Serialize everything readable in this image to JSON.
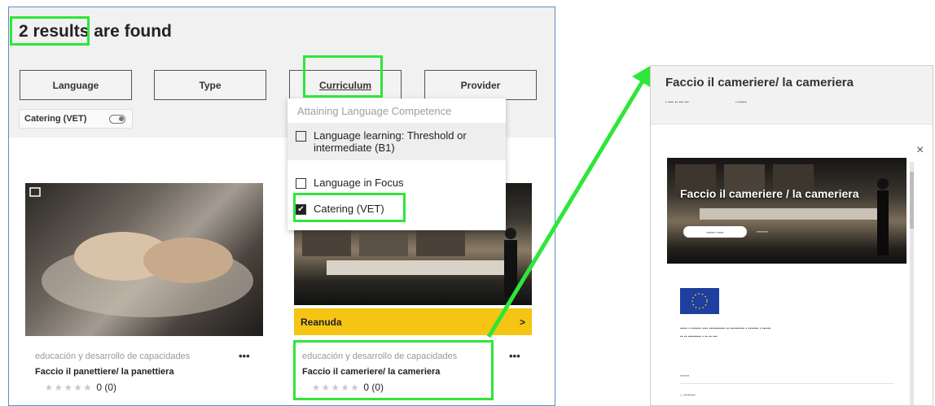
{
  "results": {
    "title": "2 results are found"
  },
  "filters": {
    "language": "Language",
    "type": "Type",
    "curriculum": "Curriculum",
    "provider": "Provider",
    "chip_label": "Catering (VET)"
  },
  "dropdown": {
    "heading": "Attaining Language Competence",
    "options": [
      {
        "label": "Language learning: Threshold or intermediate (B1)",
        "checked": false
      },
      {
        "label": "Language in Focus",
        "checked": false
      },
      {
        "label": "Catering (VET)",
        "checked": true
      }
    ]
  },
  "cards": [
    {
      "meta": "educación y desarrollo de capacidades",
      "title": "Faccio il panettiere/ la panettiera",
      "rating": "0 (0)",
      "more": "•••"
    },
    {
      "meta": "educación y desarrollo de capacidades",
      "title": "Faccio il cameriere/ la cameriera",
      "rating": "0 (0)",
      "more": "•••",
      "resume_label": "Reanuda",
      "resume_arrow": ">"
    }
  ],
  "detail": {
    "title": "Faccio il cameriere/ la cameriera",
    "hero_title": "Faccio il cameriere / la cameriera",
    "close": "×"
  },
  "colors": {
    "highlight": "#2fe63a",
    "resume_bar": "#f6c514",
    "panel_border": "#5b8fc9",
    "eu_flag": "#1d3fa0",
    "eu_stars": "#ffd400"
  },
  "icons": {
    "stars": "★★★★★",
    "checkmark": "✔"
  }
}
